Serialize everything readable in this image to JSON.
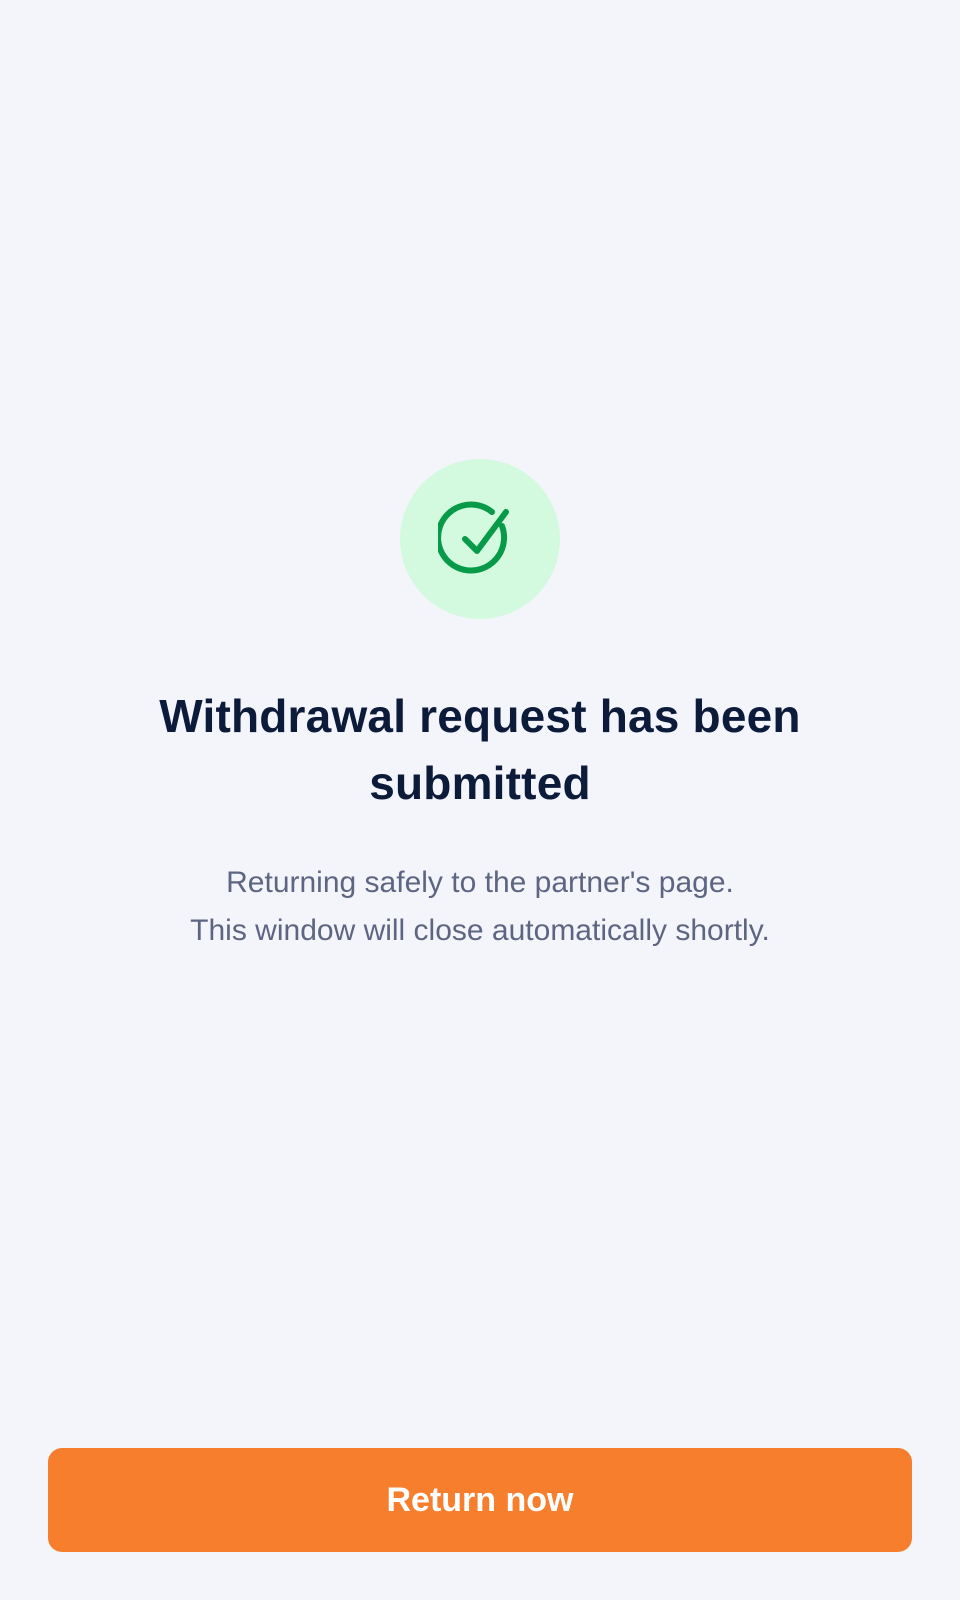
{
  "status": {
    "icon": "check-circle-icon",
    "icon_color": "#079a48",
    "icon_background": "#d3f9df",
    "title": "Withdrawal request has been submitted",
    "message_line1": "Returning safely to the partner's page.",
    "message_line2": "This window will close automatically shortly."
  },
  "actions": {
    "return_label": "Return now",
    "return_color": "#f77e2d"
  },
  "theme": {
    "background": "#f4f5fb",
    "title_color": "#0d1b3a",
    "text_color": "#5d6582"
  }
}
